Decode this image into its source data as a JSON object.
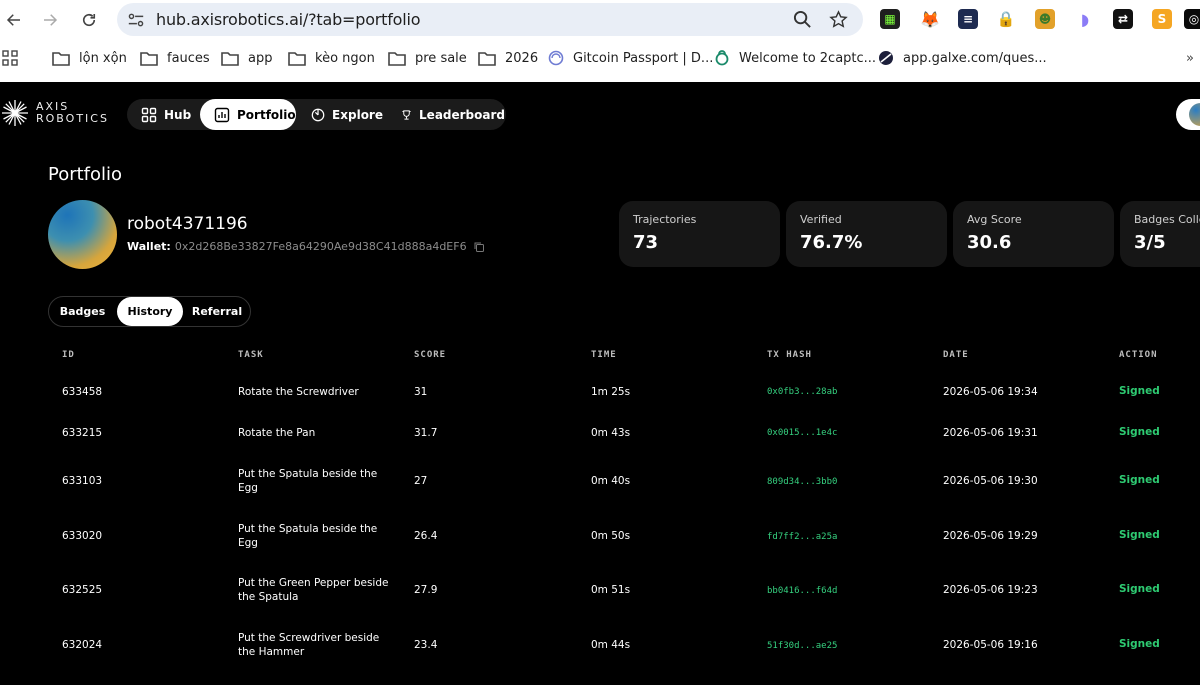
{
  "browser": {
    "url": "hub.axisrobotics.ai/?tab=portfolio",
    "bookmarks": [
      {
        "label": "lộn xộn",
        "icon": "folder-icon"
      },
      {
        "label": "fauces",
        "icon": "folder-icon"
      },
      {
        "label": "app",
        "icon": "folder-icon"
      },
      {
        "label": "kèo ngon",
        "icon": "folder-icon"
      },
      {
        "label": "pre sale",
        "icon": "folder-icon"
      },
      {
        "label": "2026",
        "icon": "folder-icon"
      },
      {
        "label": "Gitcoin Passport | D...",
        "icon": "gitcoin-icon"
      },
      {
        "label": "Welcome to 2captc...",
        "icon": "2captcha-icon"
      },
      {
        "label": "app.galxe.com/ques...",
        "icon": "galxe-icon"
      }
    ]
  },
  "app": {
    "logo_line1": "AXIS",
    "logo_line2": "ROBOTICS",
    "nav": [
      {
        "label": "Hub",
        "icon": "grid-icon"
      },
      {
        "label": "Portfolio",
        "icon": "chart-icon"
      },
      {
        "label": "Explore",
        "icon": "compass-icon"
      },
      {
        "label": "Leaderboard",
        "icon": "trophy-icon"
      }
    ],
    "page_title": "Portfolio",
    "username": "robot4371196",
    "wallet_label": "Wallet:",
    "wallet_address": "0x2d268Be33827Fe8a64290Ae9d38C41d888a4dEF6",
    "stats": [
      {
        "label": "Trajectories",
        "value": "73"
      },
      {
        "label": "Verified",
        "value": "76.7%"
      },
      {
        "label": "Avg Score",
        "value": "30.6"
      },
      {
        "label": "Badges Colle",
        "value": "3/5"
      }
    ],
    "tabs": [
      "Badges",
      "History",
      "Referral"
    ],
    "table": {
      "headers": [
        "ID",
        "TASK",
        "SCORE",
        "TIME",
        "TX HASH",
        "DATE",
        "ACTION"
      ],
      "rows": [
        {
          "id": "633458",
          "task": "Rotate the Screwdriver",
          "score": "31",
          "time": "1m 25s",
          "tx": "0x0fb3...28ab",
          "date": "2026-05-06 19:34",
          "action": "Signed"
        },
        {
          "id": "633215",
          "task": "Rotate the Pan",
          "score": "31.7",
          "time": "0m 43s",
          "tx": "0x0015...1e4c",
          "date": "2026-05-06 19:31",
          "action": "Signed"
        },
        {
          "id": "633103",
          "task": "Put the Spatula beside the Egg",
          "score": "27",
          "time": "0m 40s",
          "tx": "809d34...3bb0",
          "date": "2026-05-06 19:30",
          "action": "Signed"
        },
        {
          "id": "633020",
          "task": "Put the Spatula beside the Egg",
          "score": "26.4",
          "time": "0m 50s",
          "tx": "fd7ff2...a25a",
          "date": "2026-05-06 19:29",
          "action": "Signed"
        },
        {
          "id": "632525",
          "task": "Put the Green Pepper beside the Spatula",
          "score": "27.9",
          "time": "0m 51s",
          "tx": "bb0416...f64d",
          "date": "2026-05-06 19:23",
          "action": "Signed"
        },
        {
          "id": "632024",
          "task": "Put the Screwdriver beside the Hammer",
          "score": "23.4",
          "time": "0m 44s",
          "tx": "51f30d...ae25",
          "date": "2026-05-06 19:16",
          "action": "Signed"
        }
      ]
    }
  }
}
